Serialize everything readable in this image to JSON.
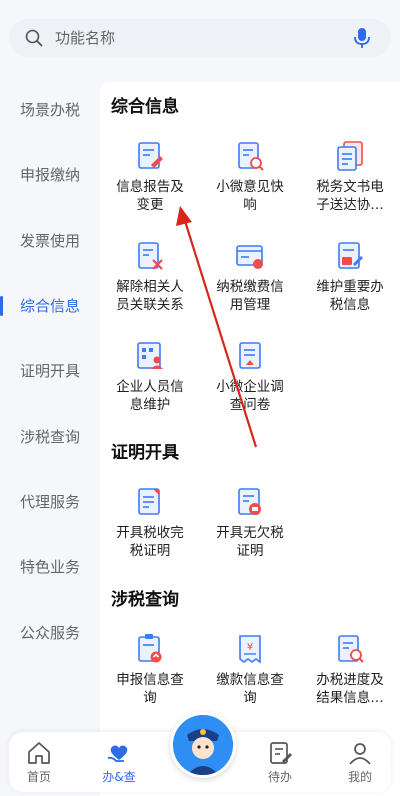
{
  "search": {
    "placeholder": "功能名称"
  },
  "sidebar": {
    "items": [
      {
        "label": "场景办税"
      },
      {
        "label": "申报缴纳"
      },
      {
        "label": "发票使用"
      },
      {
        "label": "综合信息"
      },
      {
        "label": "证明开具"
      },
      {
        "label": "涉税查询"
      },
      {
        "label": "代理服务"
      },
      {
        "label": "特色业务"
      },
      {
        "label": "公众服务"
      }
    ],
    "active": "综合信息"
  },
  "sections": [
    {
      "title": "综合信息",
      "items": [
        {
          "label_line1": "信息报告及",
          "label_line2": "变更",
          "icon": "document-edit-icon"
        },
        {
          "label_line1": "小微意见快",
          "label_line2": "响",
          "icon": "document-search-icon"
        },
        {
          "label_line1": "税务文书电",
          "label_line2": "子送达协…",
          "icon": "documents-icon"
        },
        {
          "label_line1": "解除相关人",
          "label_line2": "员关联关系",
          "icon": "document-unlink-icon"
        },
        {
          "label_line1": "纳税缴费信",
          "label_line2": "用管理",
          "icon": "credit-card-icon"
        },
        {
          "label_line1": "维护重要办",
          "label_line2": "税信息",
          "icon": "document-tax-icon"
        },
        {
          "label_line1": "企业人员信",
          "label_line2": "息维护",
          "icon": "staff-icon"
        },
        {
          "label_line1": "小微企业调",
          "label_line2": "查问卷",
          "icon": "survey-icon"
        }
      ]
    },
    {
      "title": "证明开具",
      "items": [
        {
          "label_line1": "开具税收完",
          "label_line2": "税证明",
          "icon": "certificate-icon"
        },
        {
          "label_line1": "开具无欠税",
          "label_line2": "证明",
          "icon": "certificate-stamp-icon"
        }
      ]
    },
    {
      "title": "涉税查询",
      "items": [
        {
          "label_line1": "申报信息查",
          "label_line2": "询",
          "icon": "declare-query-icon"
        },
        {
          "label_line1": "缴款信息查",
          "label_line2": "询",
          "icon": "payment-query-icon"
        },
        {
          "label_line1": "办税进度及",
          "label_line2": "结果信息…",
          "icon": "progress-query-icon"
        }
      ]
    }
  ],
  "bottom_nav": {
    "items": [
      {
        "label": "首页",
        "icon": "home-icon"
      },
      {
        "label": "办&查",
        "icon": "heart-hand-icon"
      },
      {
        "label": "待办",
        "icon": "todo-icon"
      },
      {
        "label": "我的",
        "icon": "person-icon"
      }
    ],
    "active": "办&查"
  },
  "colors": {
    "accent": "#2e6be6",
    "icon_blue": "#3d7bf0",
    "icon_red": "#f04c4c",
    "arrow": "#d9261c"
  }
}
